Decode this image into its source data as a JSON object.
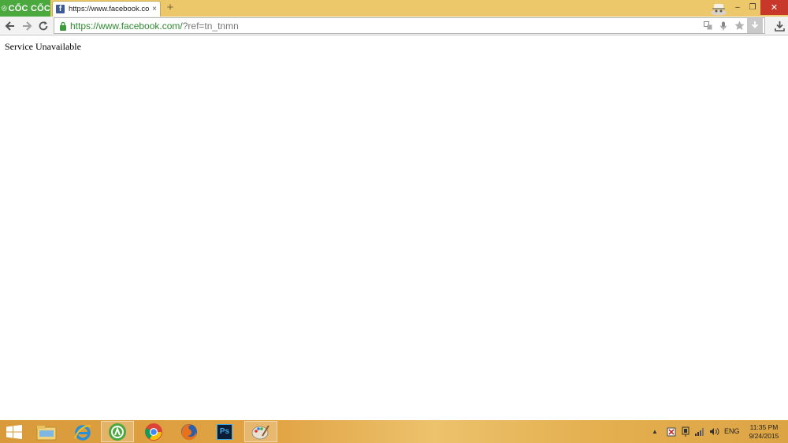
{
  "browser": {
    "brand": "CỐC CỐC",
    "tab": {
      "title": "https://www.facebook.com/?ref=tn_tnmn",
      "favicon": "facebook-icon",
      "close": "×"
    },
    "new_tab": "+",
    "window_controls": {
      "minimize": "–",
      "maximize": "❐",
      "close": "✕"
    },
    "toolbar": {
      "url_host": "https://www.facebook.com/",
      "url_path": "?ref=tn_tnmn",
      "omnibox_icons": [
        "translate-icon",
        "mic-icon",
        "star-icon",
        "download-arrow-icon"
      ]
    }
  },
  "page": {
    "message": "Service Unavailable"
  },
  "taskbar": {
    "pinned": [
      "file-explorer-icon",
      "internet-explorer-icon",
      "coccoc-icon",
      "chrome-icon",
      "firefox-icon",
      "photoshop-icon",
      "paint-icon"
    ],
    "photoshop_label": "Ps",
    "tray": {
      "chevron": "▲",
      "icons": [
        "flag-icon",
        "network-adapter-icon",
        "signal-bars-icon",
        "volume-icon"
      ],
      "language": "ENG",
      "time": "11:35 PM",
      "date": "9/24/2015"
    }
  },
  "colors": {
    "titlebar": "#ecc86a",
    "brand": "#4aa83f",
    "close_button": "#c7382a",
    "url_host": "#2f8a2f",
    "taskbar": "#e1a445"
  }
}
